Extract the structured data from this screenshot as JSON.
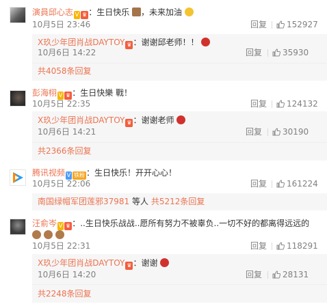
{
  "comments": [
    {
      "author": "演員邱心志",
      "text": "：生日快乐",
      "text_after": "，未来加油",
      "time": "10月5日 23:46",
      "reply_label": "回复",
      "likes": "152927",
      "reply": {
        "author": "X玖少年团肖战DAYTOY",
        "text": "：谢谢邱老师！！",
        "time": "10月6日 14:22",
        "reply_label": "回复",
        "likes": "35930"
      },
      "more": "共4058条回复"
    },
    {
      "author": "彭海栩",
      "text": "：生日快樂 戰！",
      "time": "10月5日 22:35",
      "reply_label": "回复",
      "likes": "124132",
      "reply": {
        "author": "X玖少年团肖战DAYTOY",
        "text": "：谢谢老师",
        "time": "10月6日 14:21",
        "reply_label": "回复",
        "likes": "30190"
      },
      "more": "共2366条回复"
    },
    {
      "author": "腾讯视频",
      "text": "：生日快乐！开开心心！",
      "time": "10月5日 22:06",
      "reply_label": "回复",
      "likes": "161224",
      "more_user": "南国绿帽军团莲邪37981",
      "more_mid": " 等人 ",
      "more": "共5212条回复"
    },
    {
      "author": "汪俞岑",
      "text": "：..生日快乐战战..愿所有努力不被辜负..一切不好的都离得远远的",
      "time": "10月5日 22:31",
      "reply_label": "回复",
      "likes": "118291",
      "reply": {
        "author": "X玖少年团肖战DAYTOY",
        "text": "：谢谢",
        "time": "10月6日 14:20",
        "reply_label": "回复",
        "likes": "28131"
      },
      "more": "共2248条回复"
    }
  ],
  "badges": {
    "verified": "V",
    "fan_label": "铁粉"
  },
  "colors": {
    "link": "#eb7350",
    "muted": "#808080",
    "reply_bg": "#f6f6f6"
  },
  "icons": [
    "thumbs-up-icon",
    "cake-emoji",
    "flexed-biceps-emoji",
    "rose-emoji",
    "fan-badge-icon",
    "verified-badge-icon"
  ]
}
